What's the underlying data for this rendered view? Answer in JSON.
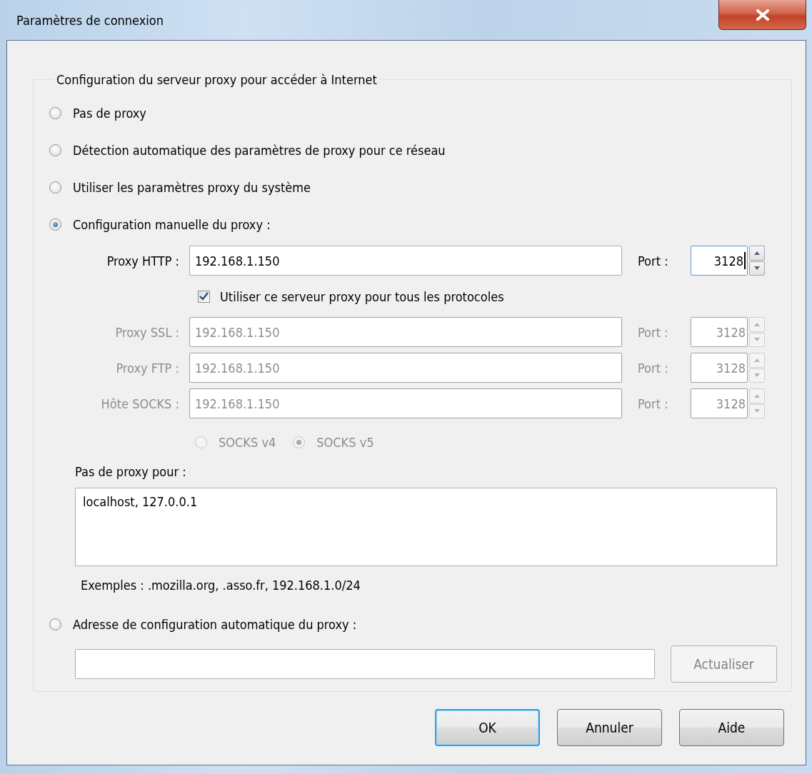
{
  "window": {
    "title": "Paramètres de connexion"
  },
  "group": {
    "legend": "Configuration du serveur proxy pour accéder à Internet"
  },
  "proxy_modes": [
    {
      "label": "Pas de proxy",
      "selected": false
    },
    {
      "label": "Détection automatique des paramètres de proxy pour ce réseau",
      "selected": false
    },
    {
      "label": "Utiliser les paramètres proxy du système",
      "selected": false
    },
    {
      "label": "Configuration manuelle du proxy :",
      "selected": true
    }
  ],
  "http": {
    "label": "Proxy HTTP :",
    "value": "192.168.1.150",
    "port_label": "Port :",
    "port": "3128",
    "focused": true
  },
  "share_all": {
    "label": "Utiliser ce serveur proxy pour tous les protocoles",
    "checked": true
  },
  "other_proxies": [
    {
      "label": "Proxy SSL :",
      "value": "192.168.1.150",
      "port_label": "Port :",
      "port": "3128",
      "disabled": true
    },
    {
      "label": "Proxy FTP :",
      "value": "192.168.1.150",
      "port_label": "Port :",
      "port": "3128",
      "disabled": true
    },
    {
      "label": "Hôte SOCKS :",
      "value": "192.168.1.150",
      "port_label": "Port :",
      "port": "3128",
      "disabled": true
    }
  ],
  "socks_versions": [
    {
      "label": "SOCKS v4",
      "selected": false,
      "disabled": true
    },
    {
      "label": "SOCKS v5",
      "selected": true,
      "disabled": true
    }
  ],
  "no_proxy": {
    "label": "Pas de proxy pour :",
    "value": "localhost, 127.0.0.1",
    "hint": "Exemples : .mozilla.org, .asso.fr, 192.168.1.0/24"
  },
  "auto_config": {
    "label": "Adresse de configuration automatique du proxy :",
    "selected": false,
    "refresh_button": {
      "label": "Actualiser",
      "disabled": true
    }
  },
  "buttons": [
    {
      "label": "OK",
      "default": true
    },
    {
      "label": "Annuler",
      "default": false
    },
    {
      "label": "Aide",
      "default": false
    }
  ]
}
